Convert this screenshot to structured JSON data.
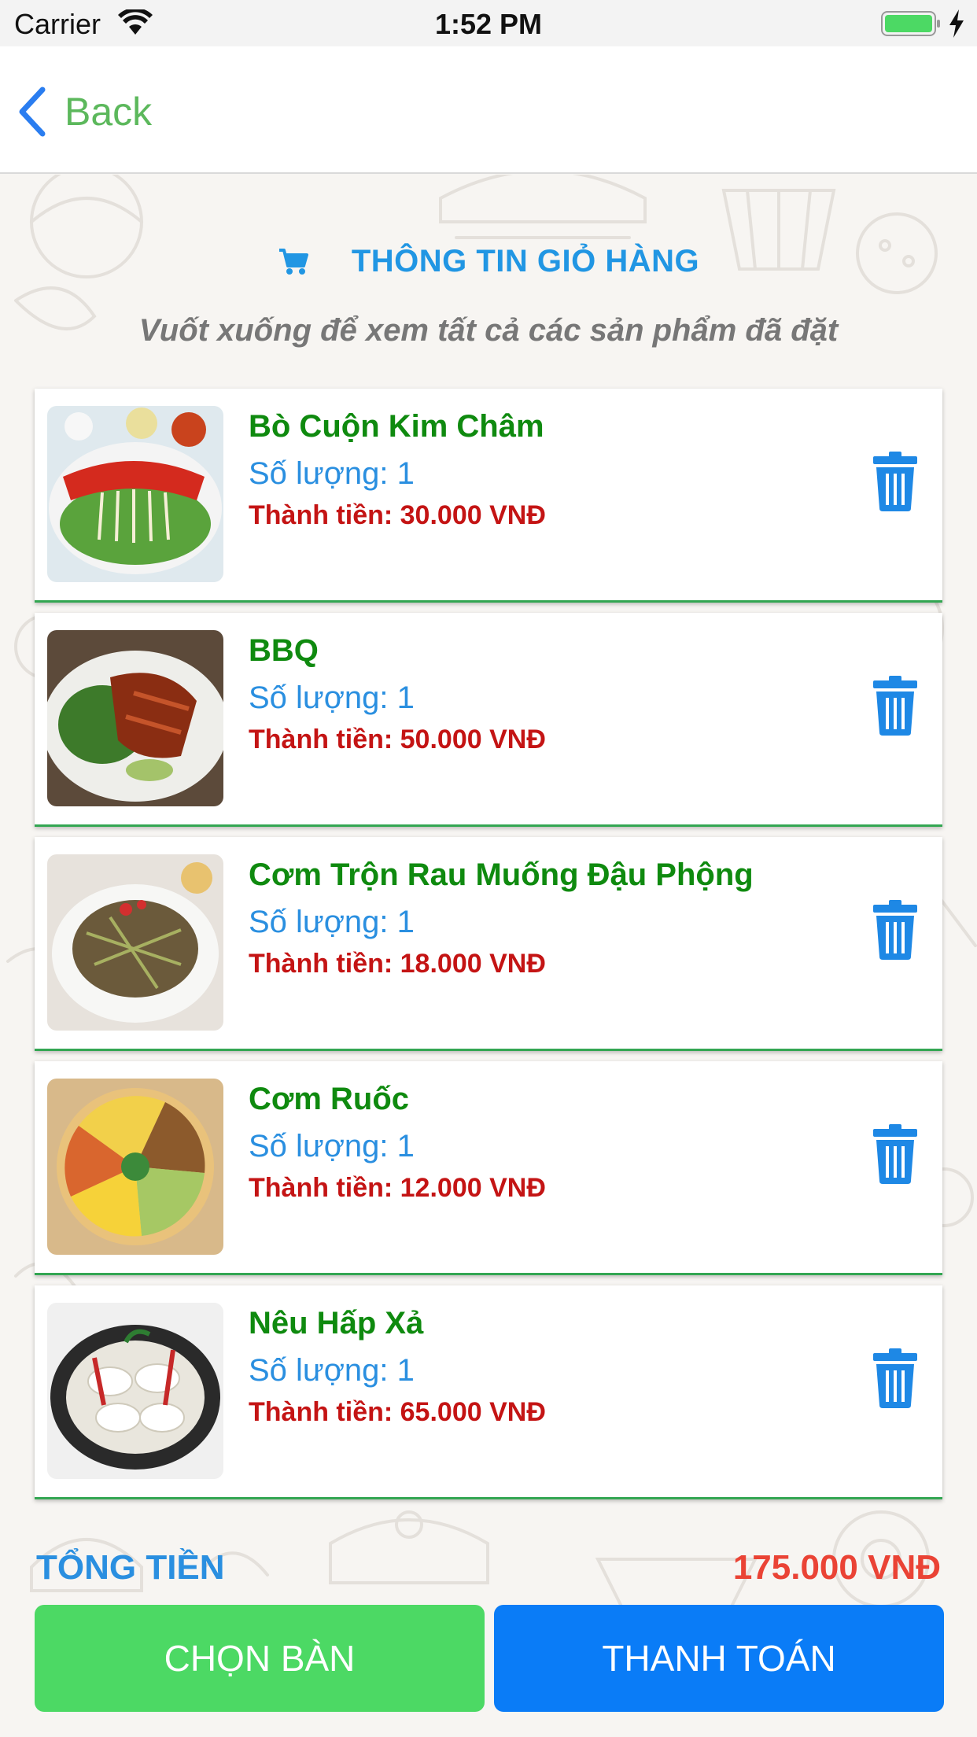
{
  "status_bar": {
    "carrier": "Carrier",
    "time": "1:52 PM"
  },
  "nav": {
    "back_label": "Back"
  },
  "header": {
    "title": "THÔNG TIN GIỎ HÀNG",
    "subtitle": "Vuốt xuống để xem tất cả các sản phẩm đã đặt"
  },
  "items": [
    {
      "name": "Bò Cuộn Kim Châm",
      "qty": "Số lượng: 1",
      "total": "Thành tiền: 30.000 VNĐ"
    },
    {
      "name": "BBQ",
      "qty": "Số lượng: 1",
      "total": "Thành tiền: 50.000 VNĐ"
    },
    {
      "name": "Cơm Trộn Rau Muống Đậu Phộng",
      "qty": "Số lượng: 1",
      "total": "Thành tiền: 18.000 VNĐ"
    },
    {
      "name": "Cơm Ruốc",
      "qty": "Số lượng: 1",
      "total": "Thành tiền: 12.000 VNĐ"
    },
    {
      "name": "Nêu Hấp Xả",
      "qty": "Số lượng: 1",
      "total": "Thành tiền: 65.000 VNĐ"
    }
  ],
  "summary": {
    "total_label": "TỔNG TIỀN",
    "total_value": "175.000 VNĐ"
  },
  "actions": {
    "choose_table": "CHỌN BÀN",
    "checkout": "THANH TOÁN"
  },
  "colors": {
    "accent_blue": "#2196e3",
    "item_green": "#0f8a0f",
    "price_red": "#c41414",
    "btn_green": "#4cd964",
    "btn_blue": "#0a7cf7",
    "total_red": "#ea4335"
  }
}
